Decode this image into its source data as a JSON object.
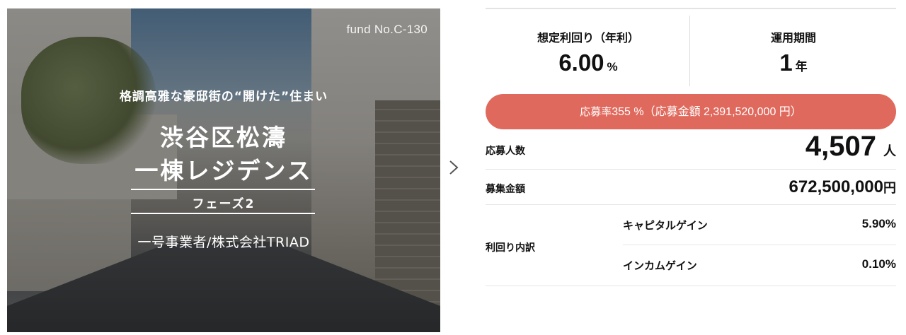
{
  "hero": {
    "fund_no": "fund No.C-130",
    "tagline": "格調高雅な豪邸街の“開けた”住まい",
    "title_line1": "渋谷区松濤",
    "title_line2": "一棟レジデンス",
    "phase": "フェーズ2",
    "operator": "一号事業者/株式会社TRIAD"
  },
  "nav": {
    "next_icon": "chevron-right-icon"
  },
  "stats": {
    "expected_yield": {
      "label": "想定利回り（年利）",
      "value": "6.00",
      "unit": "%"
    },
    "period": {
      "label": "運用期間",
      "value": "1",
      "unit": "年"
    }
  },
  "application_rate": {
    "prefix": "応募率",
    "rate": "355 %",
    "detail": "（応募金額 2,391,520,000 円）"
  },
  "details": {
    "applicants": {
      "label": "応募人数",
      "value": "4,507",
      "unit": "人"
    },
    "amount": {
      "label": "募集金額",
      "value": "672,500,000",
      "unit": "円"
    },
    "yield_breakdown": {
      "label": "利回り内訳",
      "capital_gain": {
        "label": "キャピタルゲイン",
        "value": "5.90%"
      },
      "income_gain": {
        "label": "インカムゲイン",
        "value": "0.10%"
      }
    }
  },
  "colors": {
    "accent": "#e0695d",
    "divider": "#e6e6e6"
  }
}
